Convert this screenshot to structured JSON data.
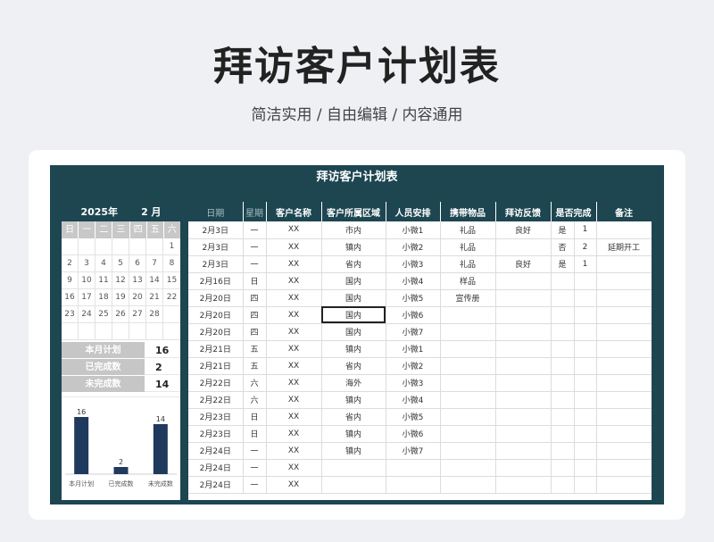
{
  "page": {
    "title": "拜访客户计划表",
    "subtitle": "简洁实用 / 自由编辑 / 内容通用"
  },
  "sheet": {
    "title": "拜访客户计划表"
  },
  "calendar": {
    "year": "2025年",
    "month": "2 月",
    "weekdays": [
      "日",
      "一",
      "二",
      "三",
      "四",
      "五",
      "六"
    ],
    "rows": [
      [
        "",
        "",
        "",
        "",
        "",
        "",
        "1"
      ],
      [
        "2",
        "3",
        "4",
        "5",
        "6",
        "7",
        "8"
      ],
      [
        "9",
        "10",
        "11",
        "12",
        "13",
        "14",
        "15"
      ],
      [
        "16",
        "17",
        "18",
        "19",
        "20",
        "21",
        "22"
      ],
      [
        "23",
        "24",
        "25",
        "26",
        "27",
        "28",
        ""
      ],
      [
        "",
        "",
        "",
        "",
        "",
        "",
        ""
      ]
    ]
  },
  "stats": [
    {
      "label": "本月计划",
      "value": "16"
    },
    {
      "label": "已完成数",
      "value": "2"
    },
    {
      "label": "未完成数",
      "value": "14"
    }
  ],
  "chart_data": {
    "type": "bar",
    "categories": [
      "本月计划",
      "已完成数",
      "未完成数"
    ],
    "values": [
      16,
      2,
      14
    ],
    "data_labels": [
      "16",
      "2",
      "14"
    ],
    "ylim": [
      0,
      18
    ],
    "color": "#1f3a5c",
    "grid": false
  },
  "table": {
    "headers": [
      "日期",
      "星期",
      "客户名称",
      "客户所属区域",
      "人员安排",
      "携带物品",
      "拜访反馈",
      "是否完成",
      "备注"
    ],
    "rows": [
      [
        "2月3日",
        "一",
        "XX",
        "市内",
        "小微1",
        "礼品",
        "良好",
        "是",
        "1",
        ""
      ],
      [
        "2月3日",
        "一",
        "XX",
        "镇内",
        "小微2",
        "礼品",
        "",
        "否",
        "2",
        "延期开工"
      ],
      [
        "2月3日",
        "一",
        "XX",
        "省内",
        "小微3",
        "礼品",
        "良好",
        "是",
        "1",
        ""
      ],
      [
        "2月16日",
        "日",
        "XX",
        "国内",
        "小微4",
        "样品",
        "",
        "",
        "",
        ""
      ],
      [
        "2月20日",
        "四",
        "XX",
        "国内",
        "小微5",
        "宣传册",
        "",
        "",
        "",
        ""
      ],
      [
        "2月20日",
        "四",
        "XX",
        "国内",
        "小微6",
        "",
        "",
        "",
        "",
        ""
      ],
      [
        "2月20日",
        "四",
        "XX",
        "国内",
        "小微7",
        "",
        "",
        "",
        "",
        ""
      ],
      [
        "2月21日",
        "五",
        "XX",
        "镇内",
        "小微1",
        "",
        "",
        "",
        "",
        ""
      ],
      [
        "2月21日",
        "五",
        "XX",
        "省内",
        "小微2",
        "",
        "",
        "",
        "",
        ""
      ],
      [
        "2月22日",
        "六",
        "XX",
        "海外",
        "小微3",
        "",
        "",
        "",
        "",
        ""
      ],
      [
        "2月22日",
        "六",
        "XX",
        "镇内",
        "小微4",
        "",
        "",
        "",
        "",
        ""
      ],
      [
        "2月23日",
        "日",
        "XX",
        "省内",
        "小微5",
        "",
        "",
        "",
        "",
        ""
      ],
      [
        "2月23日",
        "日",
        "XX",
        "镇内",
        "小微6",
        "",
        "",
        "",
        "",
        ""
      ],
      [
        "2月24日",
        "一",
        "XX",
        "镇内",
        "小微7",
        "",
        "",
        "",
        "",
        ""
      ],
      [
        "2月24日",
        "一",
        "XX",
        "",
        "",
        "",
        "",
        "",
        "",
        ""
      ],
      [
        "2月24日",
        "一",
        "XX",
        "",
        "",
        "",
        "",
        "",
        "",
        ""
      ]
    ],
    "selected_cell": {
      "row": 5,
      "col": 3
    }
  }
}
